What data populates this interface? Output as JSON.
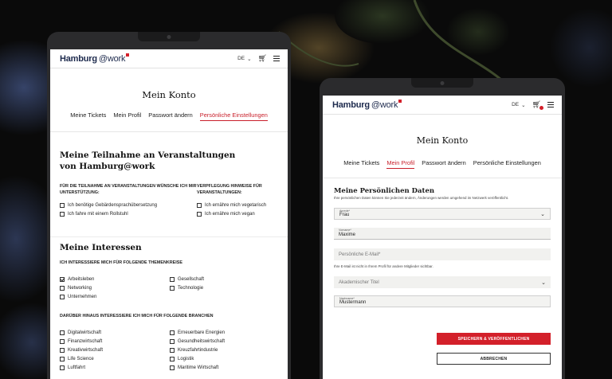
{
  "colors": {
    "accent": "#d3202a",
    "brand_navy": "#1d2a4d",
    "background": "#0a0a0a",
    "device_frame": "#2b2b2d"
  },
  "header": {
    "logo_main": "Hamburg",
    "logo_at": "@work",
    "language": "DE",
    "cart_icon": "cart-icon",
    "menu_icon": "hamburger-menu-icon"
  },
  "left_screen": {
    "title": "Mein Konto",
    "tabs": [
      {
        "label": "Meine Tickets",
        "active": false
      },
      {
        "label": "Mein Profil",
        "active": false
      },
      {
        "label": "Passwort ändern",
        "active": false
      },
      {
        "label": "Persönliche Einstellungen",
        "active": true
      }
    ],
    "participation": {
      "title": "Meine Teilnahme an Veranstaltungen von Hamburg@work",
      "support_heading": "Für die Teilnahme an Veranstaltungen wünsche ich mir Unterstützung:",
      "support_options": [
        {
          "label": "Ich benötige Gebärdensprachübersetzung",
          "checked": false
        },
        {
          "label": "Ich fahre mit einem Rollstuhl",
          "checked": false
        }
      ],
      "catering_heading": "Verpflegung Hinweise für Veranstaltungen:",
      "catering_options": [
        {
          "label": "Ich ernähre mich vegetarisch",
          "checked": false
        },
        {
          "label": "Ich ernähre mich vegan",
          "checked": false
        }
      ]
    },
    "interests": {
      "title": "Meine Interessen",
      "topics_heading": "Ich interessiere mich für folgende Themenkreise",
      "topics": [
        {
          "label": "Arbeitsleben",
          "checked": true
        },
        {
          "label": "Gesellschaft",
          "checked": false
        },
        {
          "label": "Networking",
          "checked": false
        },
        {
          "label": "Technologie",
          "checked": false
        },
        {
          "label": "Unternehmen",
          "checked": false
        }
      ],
      "industries_heading": "Darüber hinaus interessiere ich mich für folgende Branchen",
      "industries": [
        {
          "label": "Digitalwirtschaft",
          "checked": false
        },
        {
          "label": "Erneuerbare Energien",
          "checked": false
        },
        {
          "label": "Finanzwirtschaft",
          "checked": false
        },
        {
          "label": "Gesundheitswirtschaft",
          "checked": false
        },
        {
          "label": "Kreativwirtschaft",
          "checked": false
        },
        {
          "label": "Kreuzfahrtindustrie",
          "checked": false
        },
        {
          "label": "Life Science",
          "checked": false
        },
        {
          "label": "Logistik",
          "checked": false
        },
        {
          "label": "Luftfahrt",
          "checked": false
        },
        {
          "label": "Maritime Wirtschaft",
          "checked": false
        }
      ]
    }
  },
  "right_screen": {
    "title": "Mein Konto",
    "tabs": [
      {
        "label": "Meine Tickets",
        "active": false
      },
      {
        "label": "Mein Profil",
        "active": true
      },
      {
        "label": "Passwort ändern",
        "active": false
      },
      {
        "label": "Persönliche Einstellungen",
        "active": false
      }
    ],
    "section_title": "Meine Persönlichen Daten",
    "hint": "Ihre persönlichen Daten können Sie jederzeit ändern, Änderungen werden umgehend im Netzwerk veröffentlicht.",
    "fields": {
      "salutation": {
        "label": "Anrede*",
        "value": "Frau"
      },
      "first_name": {
        "label": "Vorname*",
        "value": "Maxime"
      },
      "email": {
        "placeholder": "Persönliche E-Mail*"
      },
      "academic_title": {
        "placeholder": "Akademischer Titel"
      },
      "last_name": {
        "label": "Nachname*",
        "value": "Mustermann"
      }
    },
    "email_note": "Ihre E-Mail ist nicht in Ihrem Profil für andere Mitglieder sichtbar.",
    "save_label": "Speichern & Veröffentlichen",
    "cancel_label": "Abbrechen"
  }
}
